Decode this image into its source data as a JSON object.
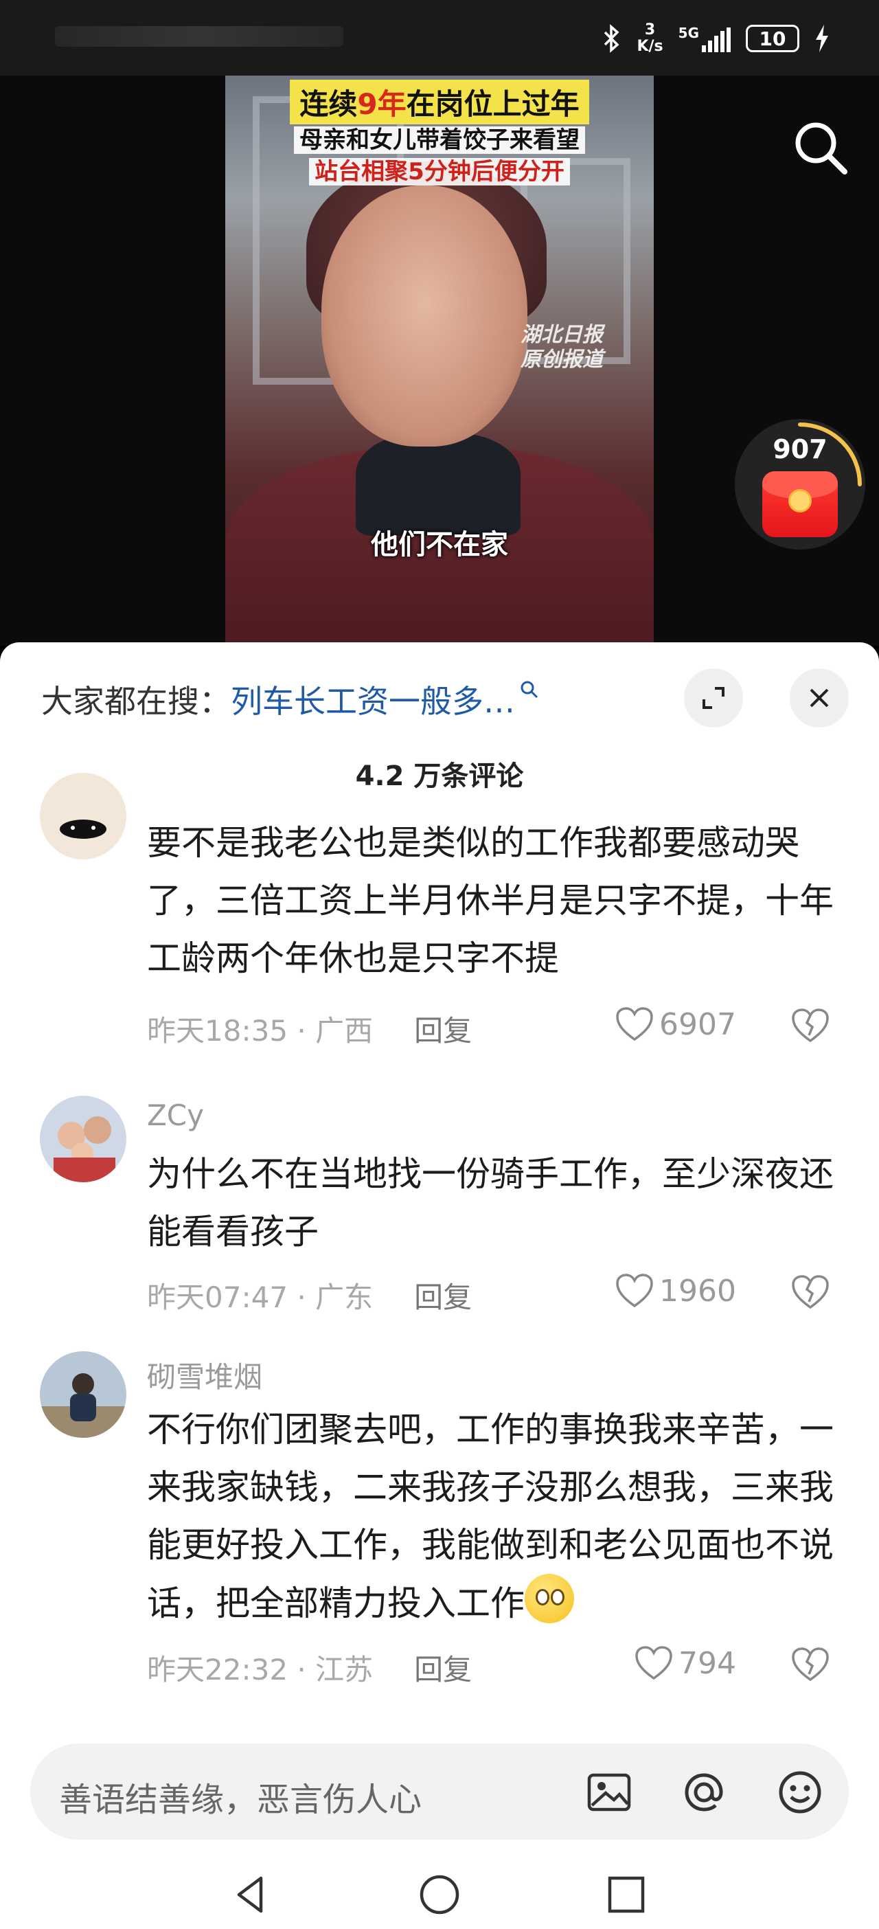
{
  "status_bar": {
    "net_speed_value": "3",
    "net_speed_unit": "K/s",
    "network": "5G",
    "signal_sub": "4G",
    "battery": "10"
  },
  "video": {
    "headline_1_prefix": "连续",
    "headline_1_highlight": "9年",
    "headline_1_suffix": "在岗位上过年",
    "headline_2": "母亲和女儿带着饺子来看望",
    "headline_3": "站台相聚5分钟后便分开",
    "watermark_1": "湖北日报",
    "watermark_2": "原创报道",
    "subtitle": "他们不在家"
  },
  "red_packet": {
    "count": "907"
  },
  "sheet": {
    "hot_search_label": "大家都在搜：",
    "hot_search_query": "列车长工资一般多…",
    "comment_count": "4.2 万条评论"
  },
  "comments": [
    {
      "name": "",
      "body": "要不是我老公也是类似的工作我都要感动哭了，三倍工资上半月休半月是只字不提，十年工龄两个年休也是只字不提",
      "time": "昨天18:35 · 广西",
      "reply": "回复",
      "likes": "6907"
    },
    {
      "name": "ZCy",
      "body": "为什么不在当地找一份骑手工作，至少深夜还能看看孩子",
      "time": "昨天07:47 · 广东",
      "reply": "回复",
      "likes": "1960"
    },
    {
      "name": "砌雪堆烟",
      "body": "不行你们团聚去吧，工作的事换我来辛苦，一来我家缺钱，二来我孩子没那么想我，三来我能更好投入工作，我能做到和老公见面也不说话，把全部精力投入工作",
      "time": "昨天22:32 · 江苏",
      "reply": "回复",
      "likes": "794"
    }
  ],
  "input": {
    "placeholder": "善语结善缘，恶言伤人心"
  },
  "icons": {
    "search": "search-icon",
    "expand": "expand-icon",
    "close": "close-icon",
    "heart": "heart-icon",
    "broken_heart": "broken-heart-icon",
    "image": "image-icon",
    "mention": "at-icon",
    "emoji": "emoji-icon",
    "back": "back-triangle-icon",
    "home": "home-circle-icon",
    "recents": "recents-square-icon"
  },
  "colors": {
    "link": "#1f5aa8",
    "headline_bg": "#f4e24a",
    "red": "#d0201a"
  }
}
